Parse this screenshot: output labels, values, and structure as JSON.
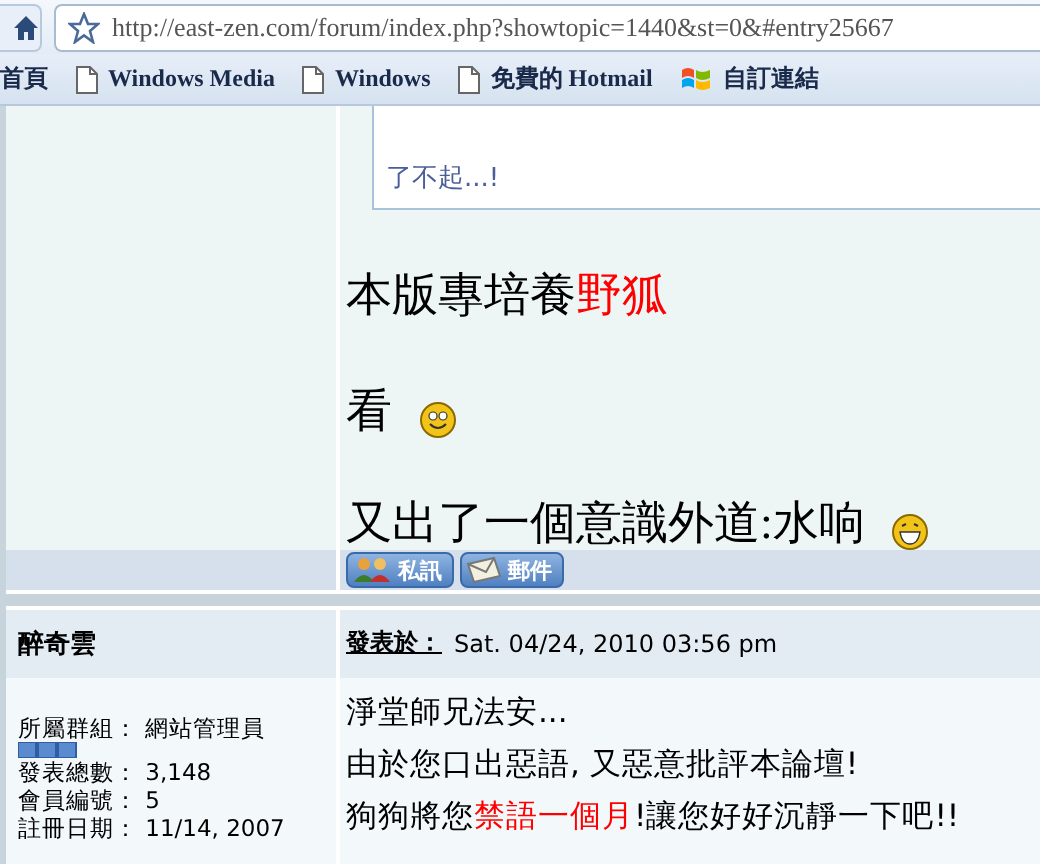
{
  "browser": {
    "url": "http://east-zen.com/forum/index.php?showtopic=1440&st=0&#entry25667",
    "bookmarks": [
      {
        "label": "首頁",
        "kind": "text"
      },
      {
        "label": "Windows Media",
        "kind": "page"
      },
      {
        "label": "Windows",
        "kind": "page"
      },
      {
        "label": "免費的 Hotmail",
        "kind": "page"
      },
      {
        "label": "自訂連結",
        "kind": "windows"
      }
    ]
  },
  "quote": {
    "text": "了不起...!"
  },
  "post_lines": [
    {
      "segments": [
        {
          "text": "本版專培養",
          "color": "#000000"
        },
        {
          "text": "野狐",
          "color": "#ff0000"
        }
      ],
      "kind": "plain"
    },
    {
      "segments": [
        {
          "text": "看",
          "color": "#000000"
        }
      ],
      "kind": "smile"
    },
    {
      "segments": [
        {
          "text": "又出了一個意識外道:水响",
          "color": "#000000"
        }
      ],
      "kind": "grin"
    }
  ],
  "post_buttons": [
    {
      "label": "私訊",
      "kind": "users"
    },
    {
      "label": "郵件",
      "kind": "mail"
    }
  ],
  "next_post": {
    "author": "醉奇雲",
    "posted_label": "發表於：",
    "posted_date": "Sat. 04/24, 2010 03:56 pm",
    "member_info": [
      {
        "label": "所屬群組：",
        "value": "網站管理員"
      },
      {
        "label": "發表總數：",
        "value": "3,148"
      },
      {
        "label": "會員編號：",
        "value": "5"
      },
      {
        "label": "註冊日期：",
        "value": "11/14, 2007"
      }
    ],
    "lines": [
      {
        "segments": [
          {
            "text": "淨堂師兄法安...",
            "color": "#000000"
          }
        ]
      },
      {
        "segments": [
          {
            "text": "由於您口出惡語, 又惡意批評本論壇!",
            "color": "#000000"
          }
        ]
      },
      {
        "segments": [
          {
            "text": "狗狗將您",
            "color": "#000000"
          },
          {
            "text": "禁語一個月",
            "color": "#ff0000"
          },
          {
            "text": "!讓您好好沉靜一下吧!!",
            "color": "#000000"
          }
        ]
      }
    ]
  }
}
